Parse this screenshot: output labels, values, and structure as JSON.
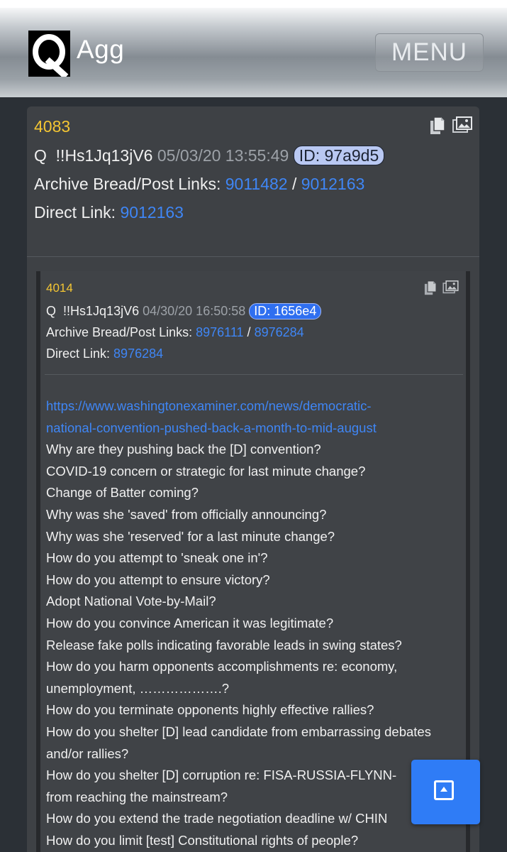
{
  "app": {
    "logo_letter": "Q",
    "title": "Agg",
    "menu_label": "MENU"
  },
  "post": {
    "number": "4083",
    "author": "Q",
    "tripcode": "!!Hs1Jq13jV6",
    "timestamp": "05/03/20 13:55:49",
    "id_badge": "ID: 97a9d5",
    "archive_label": "Archive Bread/Post Links:",
    "archive_link_1": "9011482",
    "archive_sep": "/",
    "archive_link_2": "9012163",
    "direct_label": "Direct Link:",
    "direct_link": "9012163",
    "icons": [
      "copy-icon",
      "image-icon"
    ]
  },
  "quoted": {
    "number": "4014",
    "author": "Q",
    "tripcode": "!!Hs1Jq13jV6",
    "timestamp": "04/30/20 16:50:58",
    "id_badge": "ID: 1656e4",
    "archive_label": "Archive Bread/Post Links:",
    "archive_link_1": "8976111",
    "archive_sep": "/",
    "archive_link_2": "8976284",
    "direct_label": "Direct Link:",
    "direct_link": "8976284",
    "url_line_1": "https://www.washingtonexaminer.com/news/democratic-",
    "url_line_2": "national-convention-pushed-back-a-month-to-mid-august",
    "lines": [
      "Why are they pushing back the [D] convention?",
      "COVID-19 concern or strategic for last minute change?",
      "Change of Batter coming?",
      "Why was she 'saved' from officially announcing?",
      "Why was she 'reserved' for a last minute change?",
      "How do you attempt to 'sneak one in'?",
      "How do you attempt to ensure victory?",
      "Adopt National Vote-by-Mail?",
      "How do you convince American it was legitimate?",
      "Release fake polls indicating favorable leads in swing states?",
      "How do you harm opponents accomplishments re: economy,",
      "unemployment, ……………….?",
      "How do you terminate opponents highly effective rallies?",
      "How do you shelter [D] lead candidate from embarrassing debates",
      "and/or rallies?",
      "How do you shelter [D] corruption re: FISA-RUSSIA-FLYNN-",
      "from reaching the mainstream?",
      "How do you extend the trade negotiation deadline w/ CHIN",
      "How do you limit [test] Constitutional rights of people?"
    ],
    "icons": [
      "copy-icon",
      "image-icon"
    ]
  },
  "fab": {
    "icon": "scroll-to-top-icon"
  },
  "colors": {
    "background": "#2b3036",
    "card": "#3e4145",
    "post_number": "#f4c633",
    "link": "#3f86f5",
    "fab": "#2f7cf6"
  }
}
